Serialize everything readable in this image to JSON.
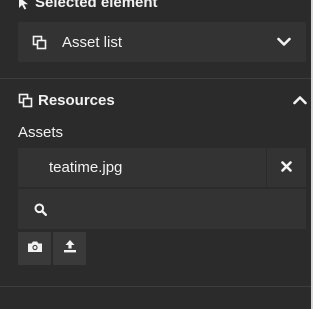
{
  "selected_element": {
    "header": "Selected element",
    "cursor_icon": "cursor-arrow-icon",
    "dropdown": {
      "value": "Asset list",
      "icon": "copy-icon",
      "chevron_icon": "chevron-down-icon"
    }
  },
  "resources": {
    "title": "Resources",
    "icon": "copy-icon",
    "collapse_icon": "chevron-up-icon",
    "assets_label": "Assets",
    "assets": [
      {
        "name": "teatime.jpg",
        "remove_icon": "close-icon"
      }
    ],
    "search": {
      "icon": "search-icon",
      "value": "",
      "placeholder": ""
    },
    "actions": [
      {
        "icon": "camera-icon"
      },
      {
        "icon": "upload-icon"
      }
    ]
  },
  "colors": {
    "panel_bg": "#2b2b2b",
    "field_bg": "#333333",
    "text": "#f2f2f2"
  }
}
